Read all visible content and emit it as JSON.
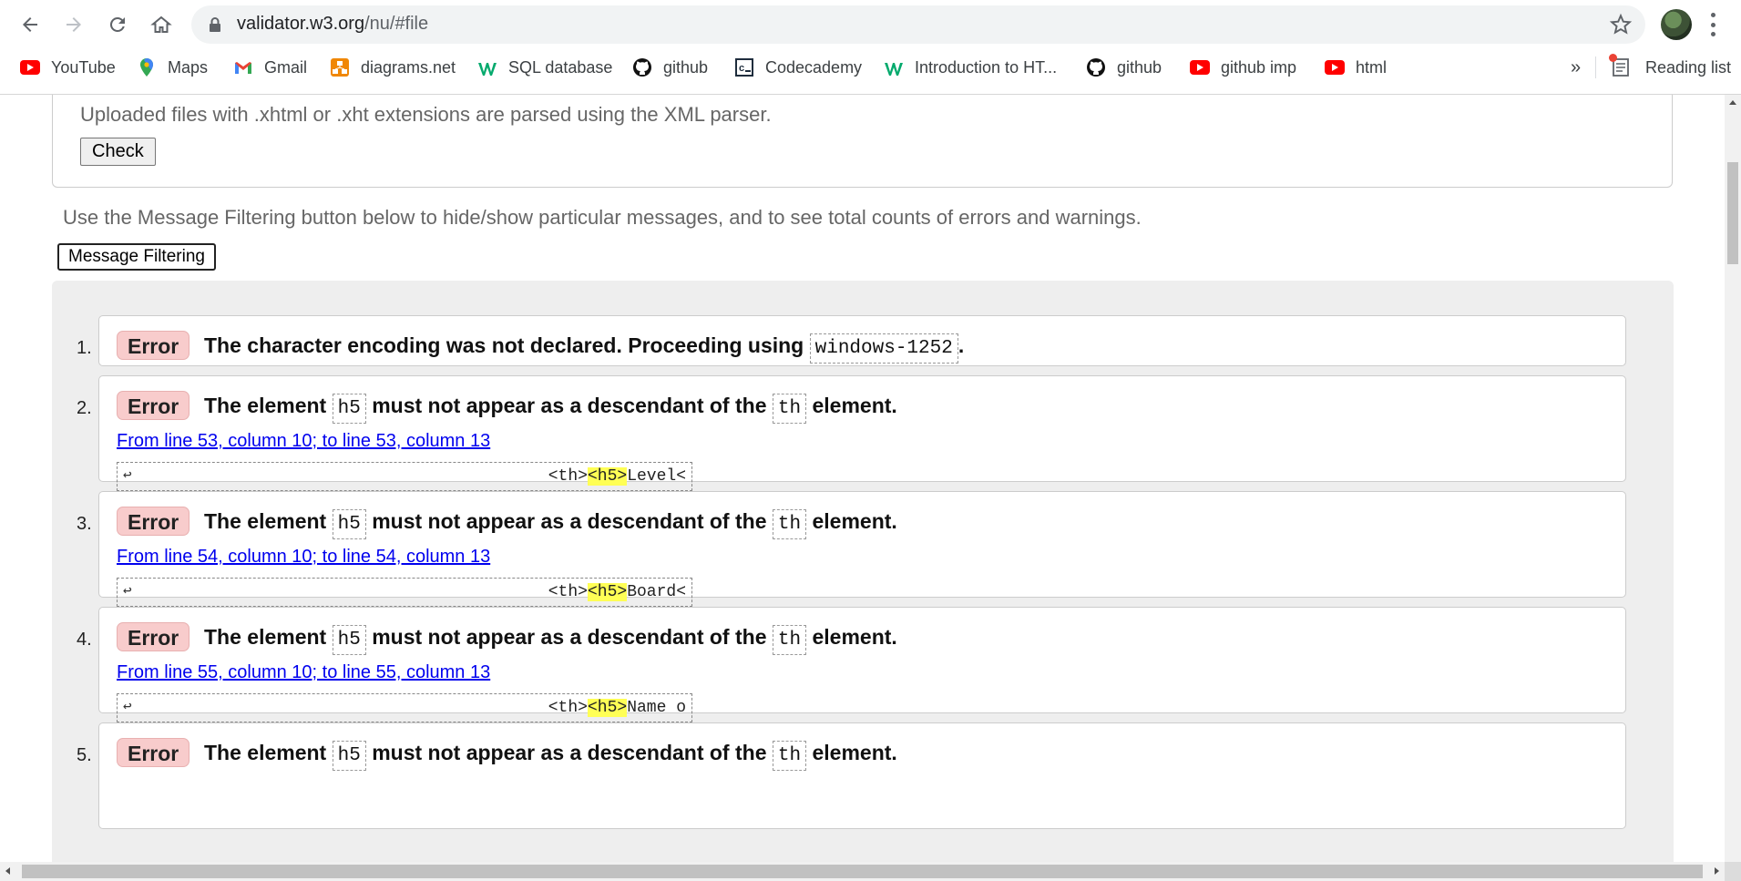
{
  "browser": {
    "url_host": "validator.w3.org",
    "url_path": "/nu/#file",
    "bookmarks": [
      {
        "label": "YouTube",
        "icon": "youtube-icon"
      },
      {
        "label": "Maps",
        "icon": "maps-icon"
      },
      {
        "label": "Gmail",
        "icon": "gmail-icon"
      },
      {
        "label": "diagrams.net",
        "icon": "diagrams-icon"
      },
      {
        "label": "SQL database",
        "icon": "w3schools-icon"
      },
      {
        "label": "github",
        "icon": "github-icon"
      },
      {
        "label": "Codecademy",
        "icon": "codecademy-icon"
      },
      {
        "label": "Introduction to HT...",
        "icon": "w3schools-icon"
      },
      {
        "label": "github",
        "icon": "github-icon"
      },
      {
        "label": "github imp",
        "icon": "youtube-icon"
      },
      {
        "label": "html",
        "icon": "youtube-icon"
      }
    ],
    "more_label": "»",
    "reading_list_label": "Reading list"
  },
  "upload": {
    "note": "Uploaded files with .xhtml or .xht extensions are parsed using the XML parser.",
    "check_label": "Check"
  },
  "filter": {
    "note": "Use the Message Filtering button below to hide/show particular messages, and to see total counts of errors and warnings.",
    "button_label": "Message Filtering"
  },
  "messages": [
    {
      "num": "1.",
      "type": "Error",
      "text_before": "The character encoding was not declared. Proceeding using",
      "code1": "windows-1252",
      "text_after": "."
    },
    {
      "num": "2.",
      "type": "Error",
      "text_before": "The element",
      "code1": "h5",
      "text_middle": "must not appear as a descendant of the",
      "code2": "th",
      "text_after": "element.",
      "location": "From line 53, column 10; to line 53, column 13",
      "extract_before": "<th>",
      "extract_highlight": "<h5>",
      "extract_after": "Level<"
    },
    {
      "num": "3.",
      "type": "Error",
      "text_before": "The element",
      "code1": "h5",
      "text_middle": "must not appear as a descendant of the",
      "code2": "th",
      "text_after": "element.",
      "location": "From line 54, column 10; to line 54, column 13",
      "extract_before": "<th>",
      "extract_highlight": "<h5>",
      "extract_after": "Board<"
    },
    {
      "num": "4.",
      "type": "Error",
      "text_before": "The element",
      "code1": "h5",
      "text_middle": "must not appear as a descendant of the",
      "code2": "th",
      "text_after": "element.",
      "location": "From line 55, column 10; to line 55, column 13",
      "extract_before": "<th>",
      "extract_highlight": "<h5>",
      "extract_after": "Name o"
    },
    {
      "num": "5.",
      "type": "Error",
      "text_before": "The element",
      "code1": "h5",
      "text_middle": "must not appear as a descendant of the",
      "code2": "th",
      "text_after": "element."
    }
  ],
  "colors": {
    "error_badge_bg": "#f8cccc",
    "link": "#0000ee",
    "highlight": "#ffff55",
    "results_bg": "#eeeeee"
  }
}
